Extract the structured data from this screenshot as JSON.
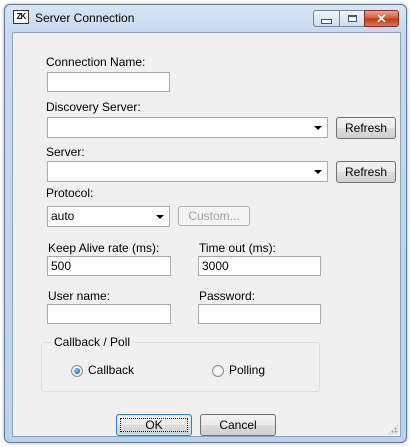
{
  "window": {
    "title": "Server Connection",
    "icon": "app-icon",
    "icon_text": "ZK"
  },
  "title_buttons": {
    "minimize": "minimize-icon",
    "maximize": "maximize-icon",
    "close": "close-icon"
  },
  "form": {
    "connection_name": {
      "label": "Connection Name:",
      "value": ""
    },
    "discovery_server": {
      "label": "Discovery Server:",
      "value": "",
      "refresh_label": "Refresh"
    },
    "server": {
      "label": "Server:",
      "value": "",
      "refresh_label": "Refresh"
    },
    "protocol": {
      "label": "Protocol:",
      "value": "auto",
      "custom_label": "Custom..."
    },
    "keep_alive": {
      "label": "Keep Alive rate (ms):",
      "value": "500"
    },
    "timeout": {
      "label": "Time out (ms):",
      "value": "3000"
    },
    "user_name": {
      "label": "User name:",
      "value": ""
    },
    "password": {
      "label": "Password:",
      "value": ""
    }
  },
  "callback_poll": {
    "legend": "Callback / Poll",
    "options": [
      {
        "label": "Callback",
        "selected": true
      },
      {
        "label": "Polling",
        "selected": false
      }
    ]
  },
  "buttons": {
    "ok": "OK",
    "cancel": "Cancel"
  },
  "colors": {
    "accent": "#2a6fbf",
    "close_button": "#c23b1b"
  }
}
